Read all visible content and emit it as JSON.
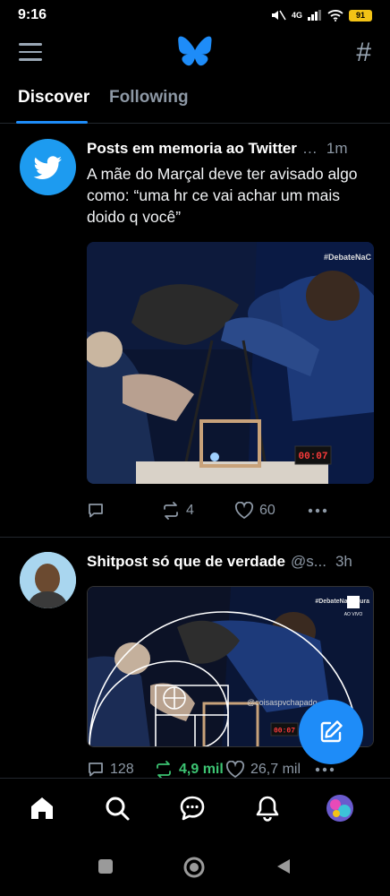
{
  "status_bar": {
    "time": "9:16",
    "network": "4G",
    "battery": "91"
  },
  "header": {
    "logo": "bluesky-butterfly-icon",
    "menu_icon": "hamburger-menu-icon",
    "feeds_icon": "hash-icon"
  },
  "tabs": [
    {
      "label": "Discover",
      "active": true
    },
    {
      "label": "Following",
      "active": false
    }
  ],
  "posts": [
    {
      "author": "Posts em memoria ao Twitter",
      "handle": "…",
      "time": "1m",
      "text": "A mãe do Marçal deve ter avisado algo como: “uma hr ce vai achar um mais doido q você”",
      "image_watermark": "#DebateNaC",
      "image_timer": "00:07",
      "reply_count": "",
      "repost_count": "4",
      "like_count": "60"
    },
    {
      "author": "Shitpost só que de verdade",
      "handle": "@s...",
      "time": "3h",
      "image_watermark": "#DebateNaCultura",
      "image_channel": "AO VIVO",
      "image_credit": "@coisaspvchapado",
      "image_timer": "00:07",
      "reply_count": "128",
      "repost_count": "4,9 mil",
      "like_count": "26,7 mil"
    }
  ],
  "colors": {
    "accent": "#1e8cf8",
    "repost_active": "#3cc372",
    "muted": "#8d98a5"
  }
}
